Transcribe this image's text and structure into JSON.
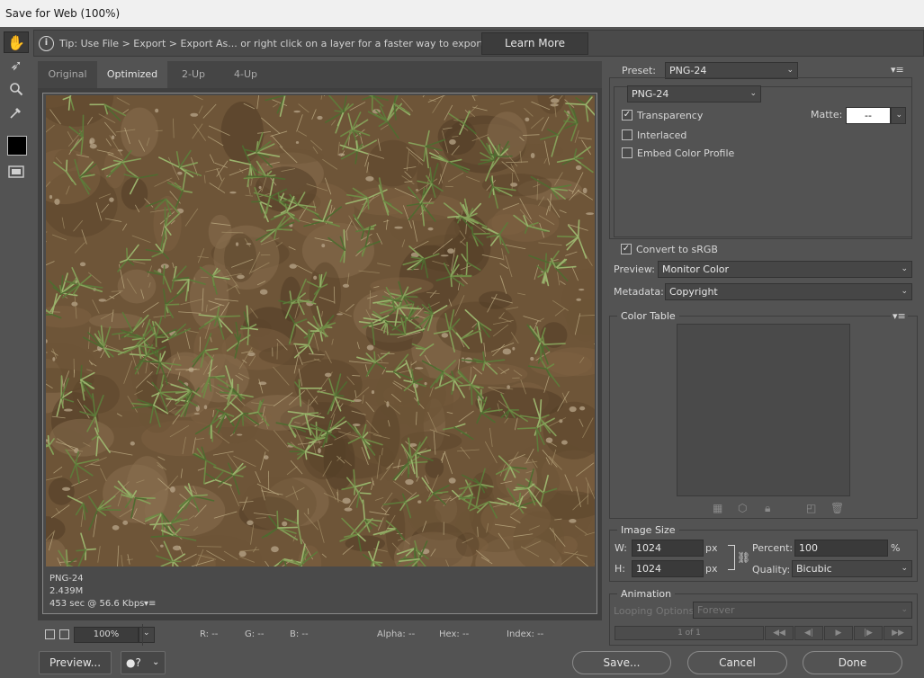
{
  "window": {
    "title": "Save for Web (100%)"
  },
  "tip": {
    "text": "Tip: Use File > Export > Export As...  or right click on a layer for a faster way to export assets",
    "learn_more": "Learn More"
  },
  "tools": [
    "hand-icon",
    "slice-select-icon",
    "zoom-icon",
    "eyedropper-icon",
    "eyedropper-color-swatch",
    "toggle-slices-icon"
  ],
  "tabs": {
    "original": "Original",
    "optimized": "Optimized",
    "two_up": "2-Up",
    "four_up": "4-Up"
  },
  "preview_info": {
    "format": "PNG-24",
    "size": "2.439M",
    "time": "453 sec @ 56.6 Kbps",
    "menu": "▾≡"
  },
  "status": {
    "zoom": "100%",
    "r": "R: --",
    "g": "G: --",
    "b": "B: --",
    "alpha": "Alpha: --",
    "hex": "Hex: --",
    "index": "Index: --"
  },
  "buttons": {
    "preview": "Preview...",
    "save": "Save...",
    "cancel": "Cancel",
    "done": "Done",
    "browser_icon": "❓"
  },
  "settings": {
    "preset_label": "Preset:",
    "preset_value": "PNG-24",
    "format_value": "PNG-24",
    "transparency": "Transparency",
    "transparency_checked": true,
    "matte_label": "Matte:",
    "matte_value": "--",
    "interlaced": "Interlaced",
    "interlaced_checked": false,
    "embed_profile": "Embed Color Profile",
    "embed_checked": false,
    "convert_srgb": "Convert to sRGB",
    "convert_checked": true,
    "preview_label": "Preview:",
    "preview_value": "Monitor Color",
    "metadata_label": "Metadata:",
    "metadata_value": "Copyright"
  },
  "color_table": {
    "title": "Color Table"
  },
  "image_size": {
    "title": "Image Size",
    "w_label": "W:",
    "w_value": "1024",
    "w_unit": "px",
    "h_label": "H:",
    "h_value": "1024",
    "h_unit": "px",
    "percent_label": "Percent:",
    "percent_value": "100",
    "percent_unit": "%",
    "quality_label": "Quality:",
    "quality_value": "Bicubic"
  },
  "animation": {
    "title": "Animation",
    "looping_label": "Looping Options:",
    "looping_value": "Forever",
    "frame_counter": "1 of 1",
    "first": "◀◀",
    "prev": "◀|",
    "play": "▶",
    "next": "|▶",
    "last": "▶▶"
  },
  "colors": {
    "panel": "#535353",
    "dark": "#3f3f3f",
    "dirt": "#6e5538",
    "grass": "#6f8a45"
  }
}
